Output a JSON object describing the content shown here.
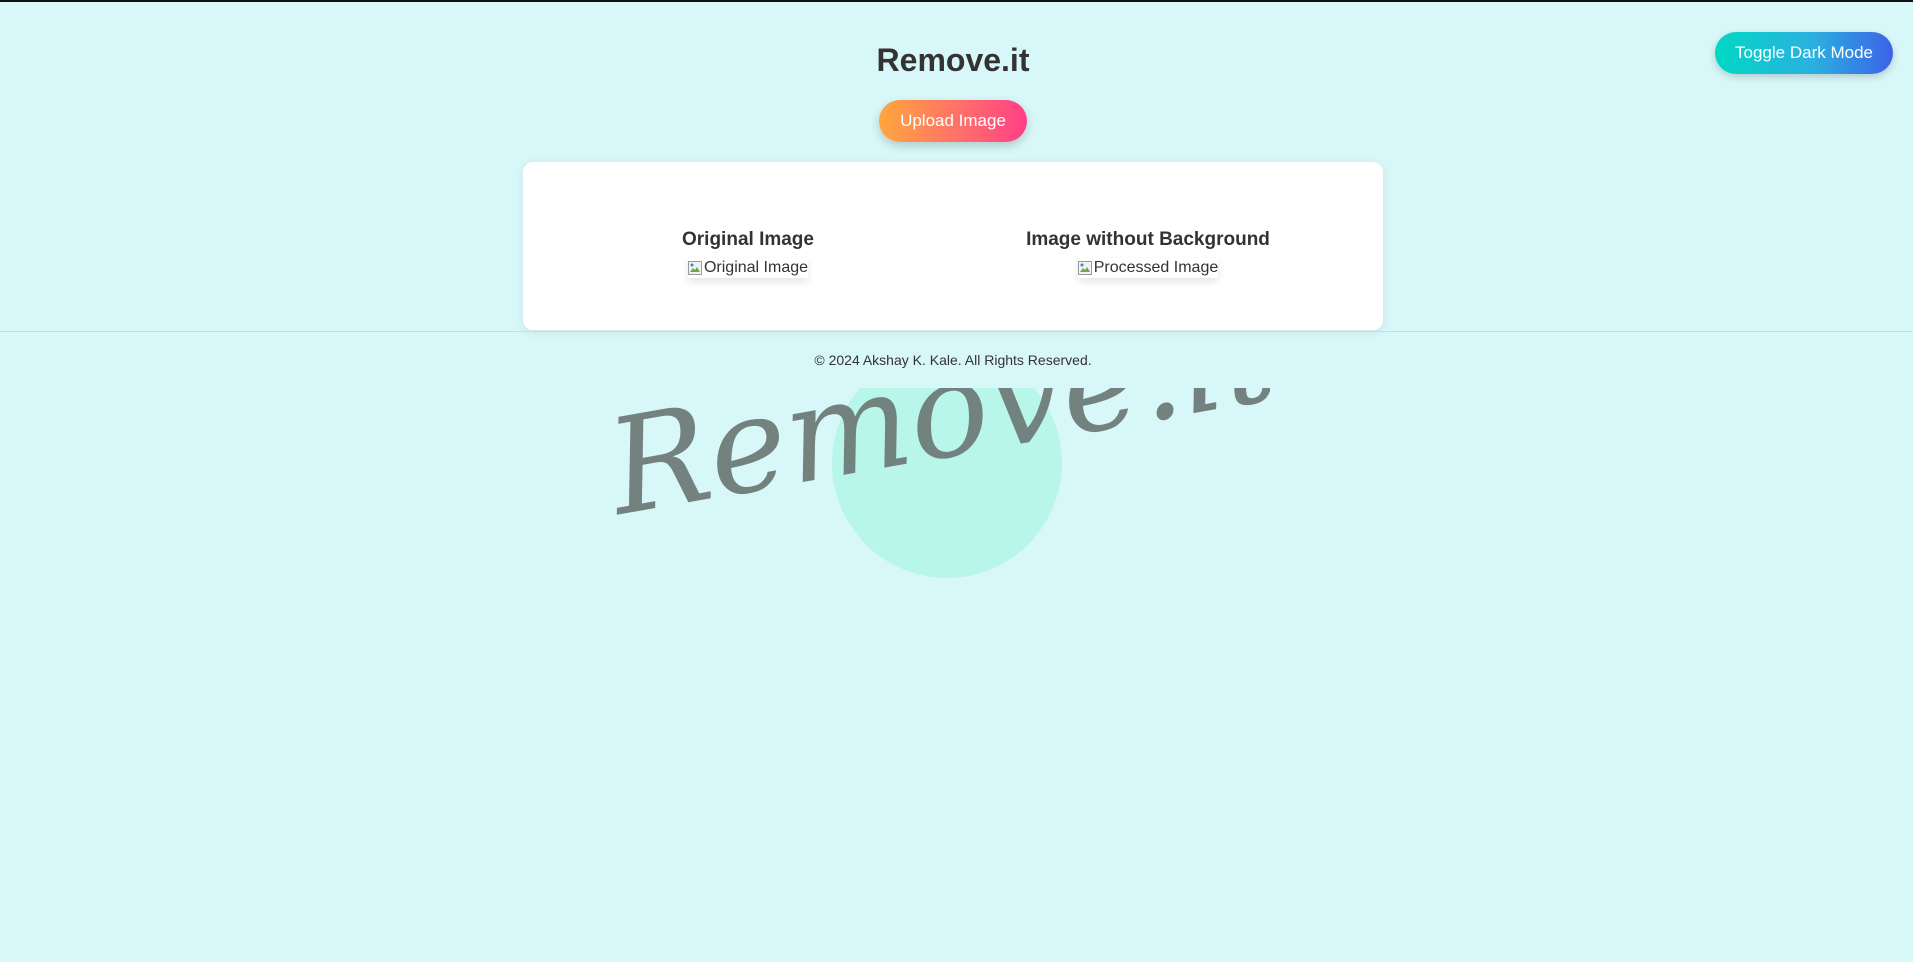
{
  "header": {
    "title": "Remove.it",
    "upload_label": "Upload Image",
    "toggle_label": "Toggle Dark Mode"
  },
  "panels": {
    "original": {
      "heading": "Original Image",
      "alt": "Original Image"
    },
    "processed": {
      "heading": "Image without Background",
      "alt": "Processed Image"
    }
  },
  "footer": {
    "copyright": "© 2024 Akshay K. Kale. All Rights Reserved."
  },
  "logo": {
    "text": "Remove.it"
  },
  "colors": {
    "background": "#d8f7f9",
    "card": "#ffffff",
    "upload_gradient": [
      "#ffa63d",
      "#ff3f86"
    ],
    "toggle_gradient": [
      "#00d8c4",
      "#3d62e6"
    ],
    "logo_text": "#6f7c79",
    "logo_circle": "#b9f6ea"
  }
}
